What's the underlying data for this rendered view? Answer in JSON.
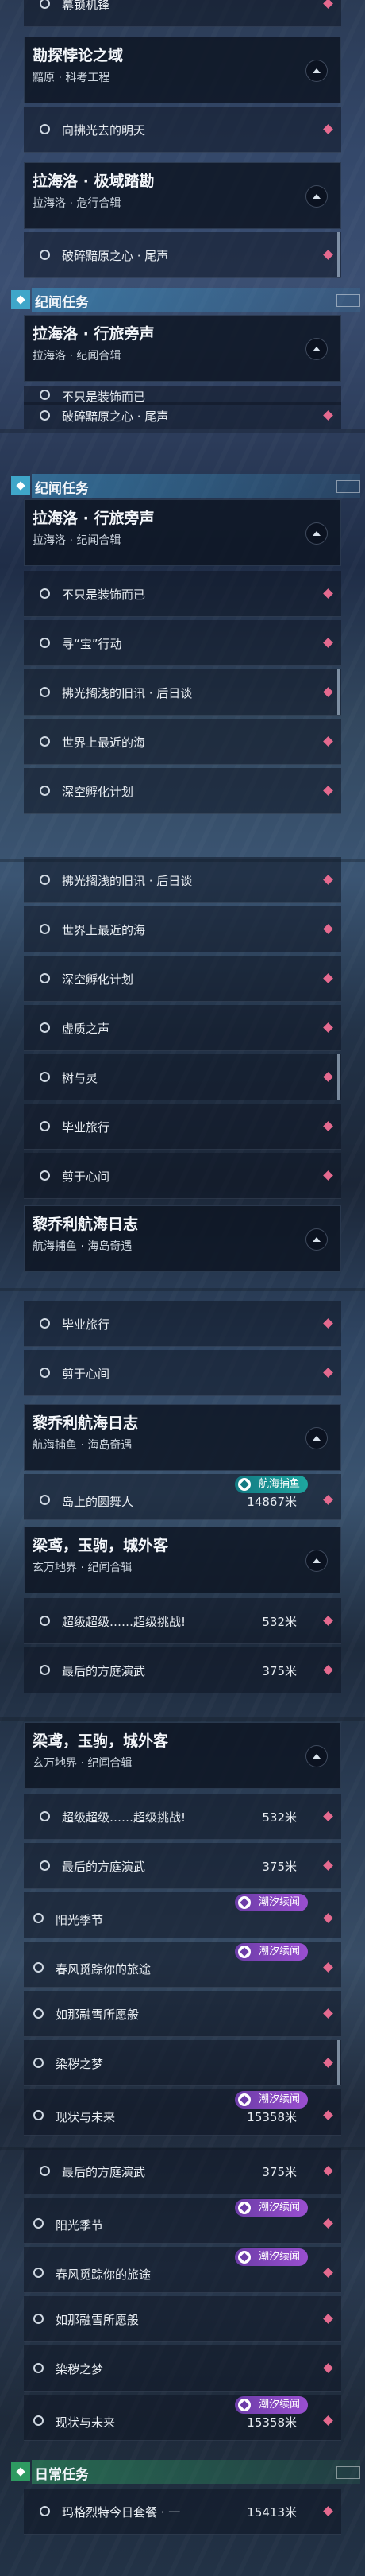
{
  "s1": {
    "top_row": "幕锁机锋",
    "card1": {
      "title": "勘探悖论之域",
      "sub": "黯原 · 科考工程"
    },
    "row1": "向拂光去的明天",
    "card2": {
      "title": "拉海洛 · 极域踏勘",
      "sub": "拉海洛 · 危行合辑"
    },
    "row2": "破碎黯原之心 · 尾声",
    "sec": "纪闻任务",
    "card3": {
      "title": "拉海洛 · 行旅旁声",
      "sub": "拉海洛 · 纪闻合辑"
    },
    "row3": "不只是装饰而已",
    "row4": "破碎黯原之心 · 尾声"
  },
  "s2": {
    "sec": "纪闻任务",
    "card": {
      "title": "拉海洛 · 行旅旁声",
      "sub": "拉海洛 · 纪闻合辑"
    },
    "rows": [
      "不只是装饰而已",
      "寻“宝”行动",
      "拂光搁浅的旧讯 · 后日谈",
      "世界上最近的海",
      "深空孵化计划"
    ]
  },
  "s3": {
    "rows": [
      "拂光搁浅的旧讯 · 后日谈",
      "世界上最近的海",
      "深空孵化计划",
      "虚质之声",
      "树与灵",
      "毕业旅行",
      "剪于心间"
    ],
    "card": {
      "title": "黎乔利航海日志",
      "sub": "航海捕鱼 · 海岛奇遇"
    }
  },
  "s4": {
    "rows": [
      "毕业旅行",
      "剪于心间"
    ],
    "card": {
      "title": "黎乔利航海日志",
      "sub": "航海捕鱼 · 海岛奇遇"
    },
    "badge": "航海捕鱼",
    "row3": {
      "label": "岛上的圆舞人",
      "value": "14867米"
    },
    "card2": {
      "title": "梁鸢，玉驹，城外客",
      "sub": "玄万地界 · 纪闻合辑"
    },
    "row4": {
      "label": "超级超级……超级挑战!",
      "value": "532米"
    },
    "row5": {
      "label": "最后的方庭演武",
      "value": "375米"
    }
  },
  "s5": {
    "card": {
      "title": "梁鸢，玉驹，城外客",
      "sub": "玄万地界 · 纪闻合辑"
    },
    "rows": [
      {
        "label": "超级超级……超级挑战!",
        "value": "532米"
      },
      {
        "label": "最后的方庭演武",
        "value": "375米"
      },
      {
        "label": "阳光季节",
        "value": ""
      },
      {
        "label": "春风觅踪你的旅途",
        "value": ""
      },
      {
        "label": "如那融雪所愿般",
        "value": ""
      },
      {
        "label": "染秽之梦",
        "value": ""
      },
      {
        "label": "现状与未来",
        "value": "15358米"
      }
    ],
    "badge": "潮汐续闻"
  },
  "s6": {
    "rows": [
      {
        "label": "最后的方庭演武",
        "value": "375米"
      },
      {
        "label": "阳光季节",
        "value": ""
      },
      {
        "label": "春风觅踪你的旅途",
        "value": ""
      },
      {
        "label": "如那融雪所愿般",
        "value": ""
      },
      {
        "label": "染秽之梦",
        "value": ""
      },
      {
        "label": "现状与未来",
        "value": "15358米"
      }
    ],
    "badge": "潮汐续闻",
    "sec": "日常任务",
    "last": {
      "label": "玛格烈特今日套餐 · 一",
      "value": "15413米"
    }
  },
  "colors": {
    "accent_blue": "#3fa6c9",
    "accent_green": "#2e9a61",
    "badge_purple": "#6d3da8",
    "diamond": "#e56a8f"
  }
}
